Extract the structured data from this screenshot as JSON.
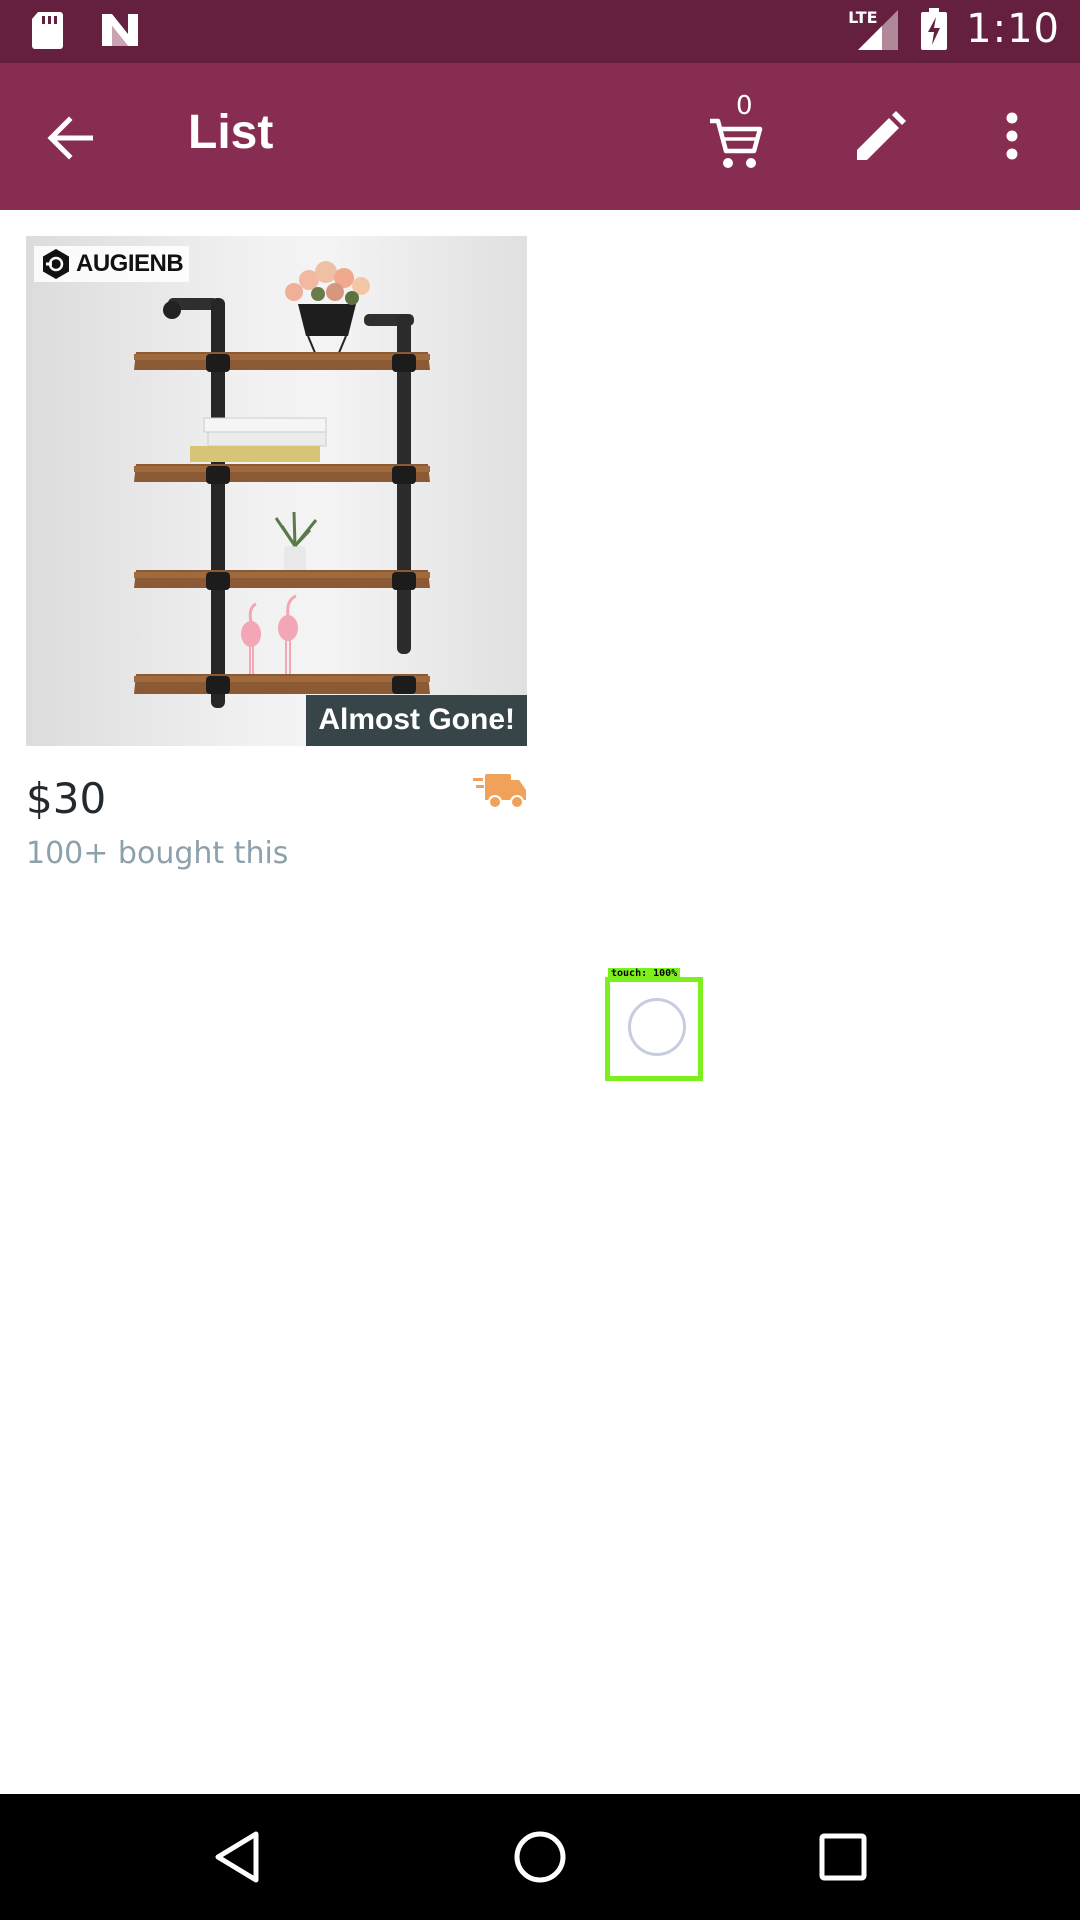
{
  "status_bar": {
    "time": "1:10",
    "network": "LTE",
    "icons": [
      "sd-card-icon",
      "n-notification-icon",
      "lte-signal-icon",
      "battery-charging-icon"
    ]
  },
  "app_bar": {
    "title": "List",
    "cart_count": "0",
    "icons": [
      "back-arrow-icon",
      "cart-icon",
      "edit-pencil-icon",
      "more-vert-icon"
    ]
  },
  "product": {
    "brand": "AUGIENB",
    "badge": "Almost Gone!",
    "price": "$30",
    "bought": "100+ bought this",
    "image_description": "three-tier pipe wall shelf",
    "icons": [
      "fast-shipping-truck-icon"
    ]
  },
  "touch_overlay": {
    "label": "touch: 100%",
    "accent_color": "#7cf01e"
  },
  "nav_bar": {
    "icons": [
      "nav-back-icon",
      "nav-home-icon",
      "nav-recents-icon"
    ]
  },
  "colors": {
    "status_bar": "#66203f",
    "app_bar": "#862d51",
    "badge_bg": "#374448",
    "shipping_icon": "#f0a25a",
    "secondary_text": "#8da1ac"
  }
}
